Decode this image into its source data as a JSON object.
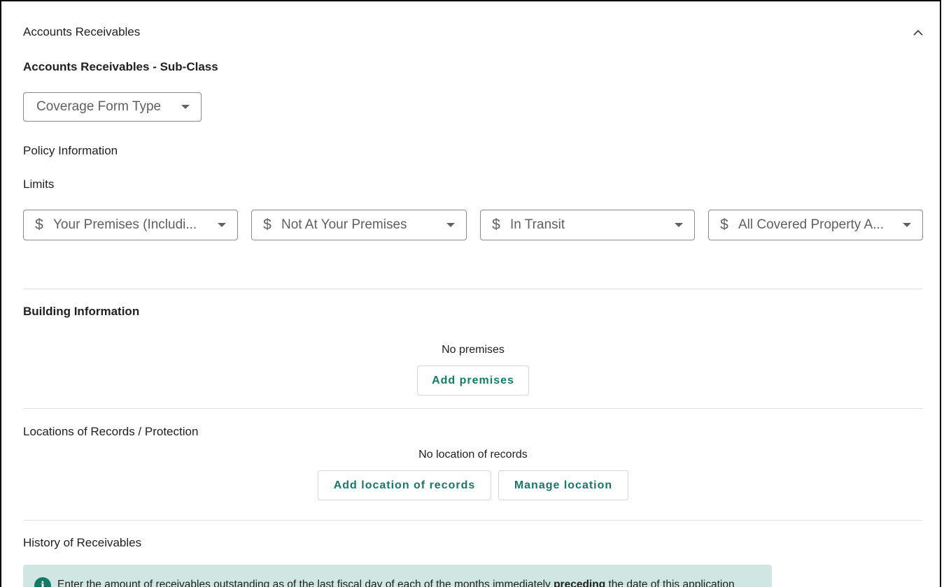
{
  "panel": {
    "title": "Accounts Receivables",
    "collapse_icon": "chevron-up-icon"
  },
  "subclass": {
    "heading": "Accounts Receivables - Sub-Class",
    "coverage_form_placeholder": "Coverage Form Type"
  },
  "policy": {
    "heading": "Policy Information",
    "limits_label": "Limits",
    "currency_symbol": "$",
    "limits": [
      {
        "placeholder": "Your Premises (Includi..."
      },
      {
        "placeholder": "Not At Your Premises"
      },
      {
        "placeholder": "In Transit"
      },
      {
        "placeholder": "All Covered Property A..."
      }
    ]
  },
  "building": {
    "heading": "Building Information",
    "empty_text": "No premises",
    "add_button": "Add premises"
  },
  "records": {
    "heading": "Locations of Records / Protection",
    "empty_text": "No location of records",
    "add_button": "Add location of records",
    "manage_button": "Manage location"
  },
  "history": {
    "heading": "History of Receivables",
    "info_icon": "info-icon",
    "info_text_before": "Enter the amount of receivables outstanding as of the last fiscal day of each of the months immediately ",
    "info_text_bold": "preceding",
    "info_text_after": " the date of this application"
  },
  "colors": {
    "accent": "#137a68",
    "banner_bg": "#cfe6e2",
    "divider": "#e0e0e0"
  }
}
